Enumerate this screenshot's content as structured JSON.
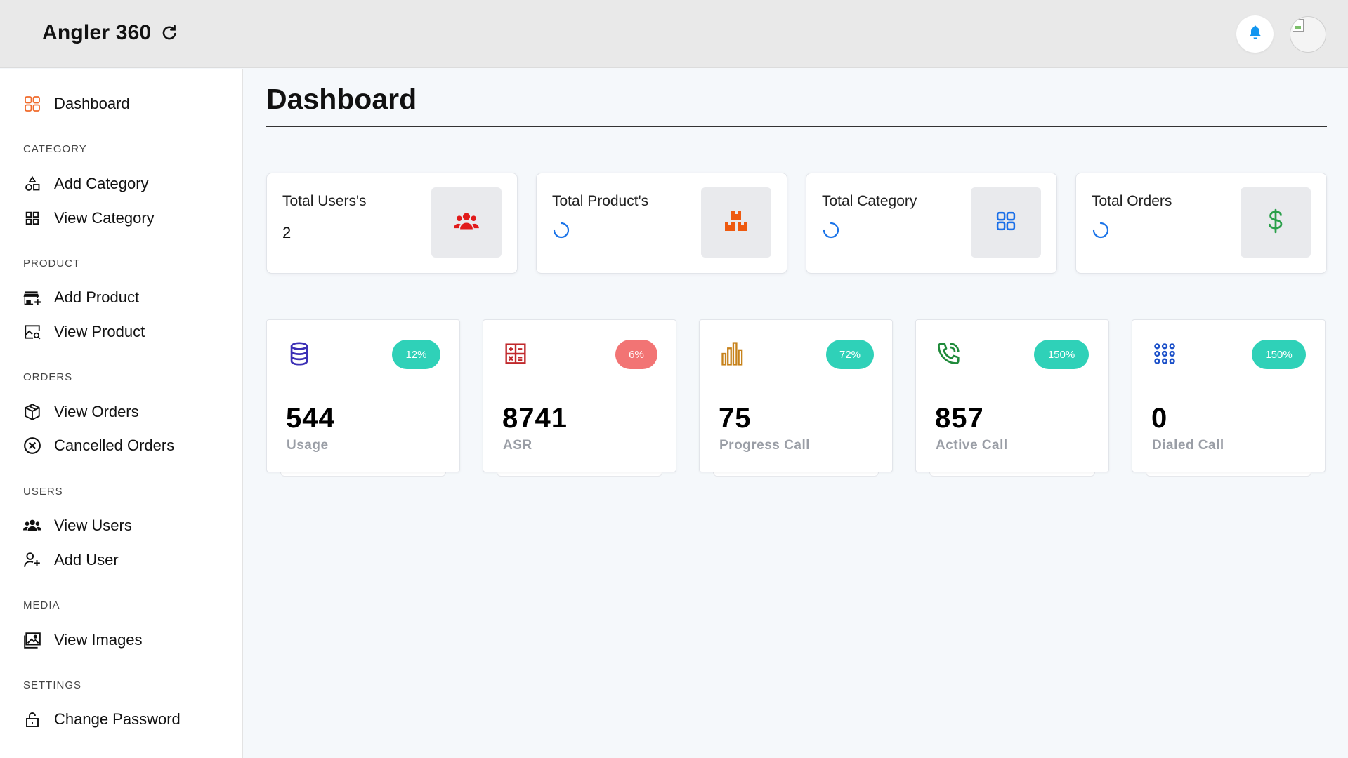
{
  "header": {
    "brand": "Angler 360"
  },
  "sidebar": {
    "dashboard": "Dashboard",
    "sections": {
      "category": "CATEGORY",
      "product": "PRODUCT",
      "orders": "ORDERS",
      "users": "USERS",
      "media": "MEDIA",
      "settings": "SETTINGS"
    },
    "items": {
      "add_category": "Add Category",
      "view_category": "View Category",
      "add_product": "Add Product",
      "view_product": "View Product",
      "view_orders": "View Orders",
      "cancelled_orders": "Cancelled Orders",
      "view_users": "View Users",
      "add_user": "Add User",
      "view_images": "View Images",
      "change_password": "Change Password"
    },
    "accent": "#f06a2a"
  },
  "main": {
    "title": "Dashboard",
    "stats": [
      {
        "label": "Total Users's",
        "value": "2",
        "icon": "users-icon",
        "icon_color": "#e11b1b"
      },
      {
        "label": "Total Product's",
        "value": null,
        "icon": "boxes-icon",
        "icon_color": "#ee5a10",
        "loading": true
      },
      {
        "label": "Total Category",
        "value": null,
        "icon": "grid-icon",
        "icon_color": "#1a6fe8",
        "loading": true
      },
      {
        "label": "Total Orders",
        "value": null,
        "icon": "dollar-icon",
        "icon_color": "#2aa04a",
        "loading": true
      }
    ],
    "metrics": [
      {
        "value": "544",
        "caption": "Usage",
        "badge": "12%",
        "badge_color": "#2fd1b8",
        "icon": "database-icon",
        "icon_color": "#3b2fb5"
      },
      {
        "value": "8741",
        "caption": "ASR",
        "badge": "6%",
        "badge_color": "#f27474",
        "icon": "calculator-icon",
        "icon_color": "#c0282b"
      },
      {
        "value": "75",
        "caption": "Progress Call",
        "badge": "72%",
        "badge_color": "#2fd1b8",
        "icon": "bar-chart-icon",
        "icon_color": "#c7821b"
      },
      {
        "value": "857",
        "caption": "Active Call",
        "badge": "150%",
        "badge_color": "#2fd1b8",
        "icon": "phone-icon",
        "icon_color": "#1f8a3a"
      },
      {
        "value": "0",
        "caption": "Dialed Call",
        "badge": "150%",
        "badge_color": "#2fd1b8",
        "icon": "dialpad-icon",
        "icon_color": "#1a4fc8"
      }
    ]
  }
}
